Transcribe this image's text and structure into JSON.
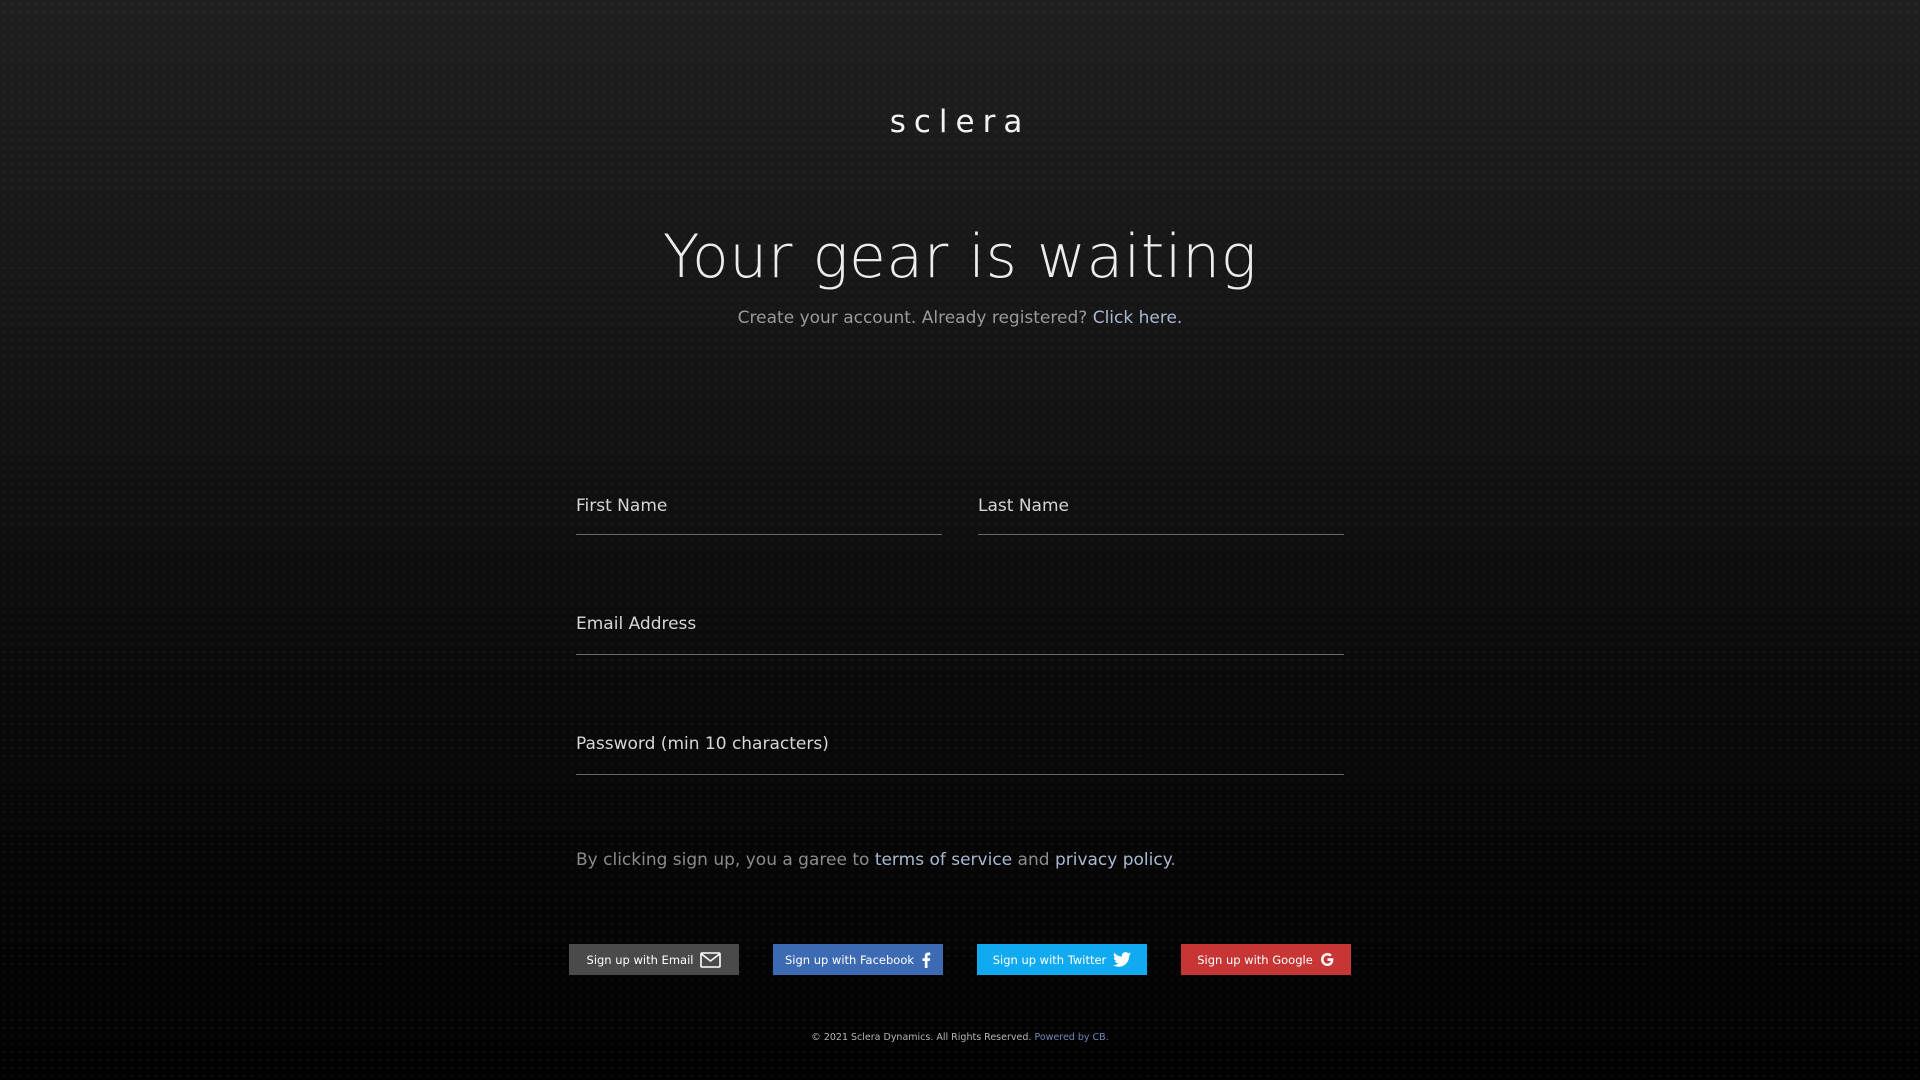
{
  "brand": {
    "logo_text": "sclera"
  },
  "hero": {
    "headline": "Your gear is waiting",
    "subtitle_text": "Create your account. Already registered?",
    "login_link": "Click here."
  },
  "form": {
    "first_name": {
      "placeholder": "First Name",
      "value": ""
    },
    "last_name": {
      "placeholder": "Last Name",
      "value": ""
    },
    "email": {
      "placeholder": "Email Address",
      "value": ""
    },
    "password": {
      "placeholder": "Password (min 10 characters)",
      "value": ""
    }
  },
  "terms": {
    "prefix": "By clicking  sign up, you a garee to",
    "tos_link": "terms of service",
    "conjunction": "and",
    "privacy_link": "privacy policy",
    "suffix": "."
  },
  "signup_buttons": {
    "email": {
      "label": "Sign up with Email",
      "icon": "envelope-icon",
      "color": "#4a4a4a"
    },
    "facebook": {
      "label": "Sign up with Facebook",
      "icon": "facebook-icon",
      "color": "#3d6bb3"
    },
    "twitter": {
      "label": "Sign up with Twitter",
      "icon": "twitter-icon",
      "color": "#10aaf1"
    },
    "google": {
      "label": "Sign up with Google",
      "icon": "google-icon",
      "color": "#c73535"
    }
  },
  "footer": {
    "copyright": "© 2021 Sclera Dynamics. All Rights Reserved.",
    "powered_by": "Powered by CB."
  },
  "colors": {
    "background": "#0c0c0c",
    "link": "#a9b9d3",
    "field_underline": "#6a6a6a"
  }
}
